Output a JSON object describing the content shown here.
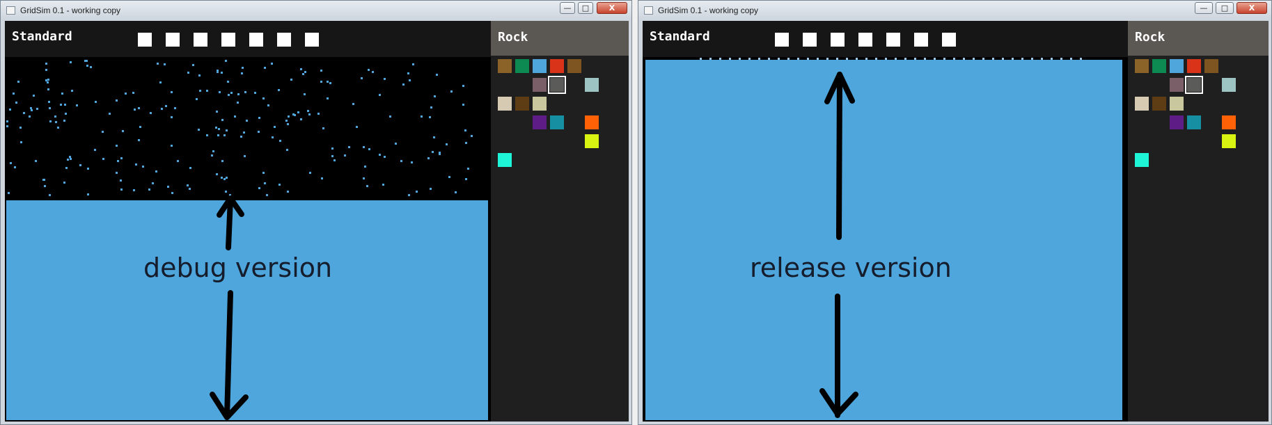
{
  "windows": [
    {
      "title": "GridSim 0.1 - working copy",
      "mode_label": "Standard",
      "material_name": "Rock",
      "caption": "debug version",
      "minimize_glyph": "—",
      "maximize_glyph": "□",
      "close_glyph": "X"
    },
    {
      "title": "GridSim 0.1 - working copy",
      "mode_label": "Standard",
      "material_name": "Rock",
      "caption": "release version",
      "minimize_glyph": "—",
      "maximize_glyph": "□",
      "close_glyph": "X"
    }
  ],
  "palette_colors": [
    "#8b6228",
    "#0d8a52",
    "#4ea6dd",
    "#d9341a",
    "#7e5520",
    "#7a5f69",
    "#5b5b59",
    "#9dc4c2",
    "#d6cab3",
    "#5e3c14",
    "#c9c79e",
    "#5d1c86",
    "#168fa3",
    "#ff6206",
    "#d9f411",
    "#1ef5d7"
  ],
  "selected_material_color": "#5b5b59",
  "water_color": "#4ea6dd",
  "icons": [
    "app-icon",
    "minimize-icon",
    "maximize-icon",
    "close-icon",
    "arrow-up-icon",
    "arrow-down-icon"
  ]
}
